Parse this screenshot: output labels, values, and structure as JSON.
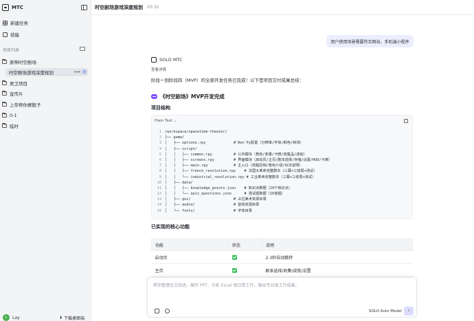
{
  "app": {
    "brand": "MTC"
  },
  "sidebar": {
    "new_task": "新建任务",
    "skills": "技能",
    "projects_label": "项目列表",
    "projects": [
      {
        "label": "原神时空剧场"
      },
      {
        "label": "时空剧场游戏深度规划",
        "active": true
      },
      {
        "label": "吴卫项目"
      },
      {
        "label": "宣传片"
      },
      {
        "label": "上帝帮你掷骰子"
      },
      {
        "label": "0-1"
      },
      {
        "label": "临时"
      }
    ],
    "user_name": "Lay",
    "user_initial": "L",
    "download": "下载桌面端"
  },
  "header": {
    "title": "时空剧场游戏深度规划",
    "time": "20:32"
  },
  "chat": {
    "user_message": "用户使用场景需要符合网站、手机端小程序",
    "agent_name": "SOLO MTC",
    "view_detail": "查看详情",
    "summary": "阶段一到阶段四（MVP）的全部开发任务已完成！以下是项目交付成果总结：",
    "mvp_title": "《时空剧场》MVP开发完成",
    "structure_title": "项目结构",
    "code_lang": "Plain Text",
    "code_lines": [
      "/workspace/spacetime-theater/",
      "├── game/",
      "│   ├── options.rpy             # Ren'Py配置（分辨率/字体/颜色/转场）",
      "│   ├── script/",
      "│   │   ├── common.rpy          # 公共模块（角色/变量/卡牌/收集品/成就）",
      "│   │   ├── screens.rpy         # 界面模块（启动页/主页/剧本选择/存储/设置/HUD/卡牌）",
      "│   │   ├── main.rpy            # 主入口（流程控制/角色介绍/玩法说明）",
      "│   │   ├── french_revolution.rpy    # 法国大革命完整剧本（三幕+三结局+测试）",
      "│   │   └── industrial_revolution.rpy # 工业革命完整剧本（三幕+三结局+测试）",
      "│   ├── data/",
      "│   │   ├── knowledge_points.json    # 知识点数据（29个知识点）",
      "│   │   └── quiz_questions.json      # 测试题数据（10道题）",
      "│   ├── gui/                    # 占位美术资源目录",
      "│   ├── audio/                  # 音效资源目录",
      "│   └── fonts/                  # 字体目录"
    ],
    "features_title": "已实现的核心功能",
    "table_headers": [
      "功能",
      "状态",
      "说明"
    ],
    "table_rows": [
      {
        "feature": "启动页",
        "desc": "2-3秒自动跳转"
      },
      {
        "feature": "主页",
        "desc": "剧本选择/收集/成就/设置"
      }
    ]
  },
  "composer": {
    "placeholder": "帮你整理论文综述、编写 PPT、分析 Excel 每日常工作、输出专业级工作成果。",
    "model": "SOLO Auto Model"
  },
  "colors": {
    "accent": "#4a6cf7",
    "success": "#3fbf5f",
    "bubble": "#eceefe"
  }
}
